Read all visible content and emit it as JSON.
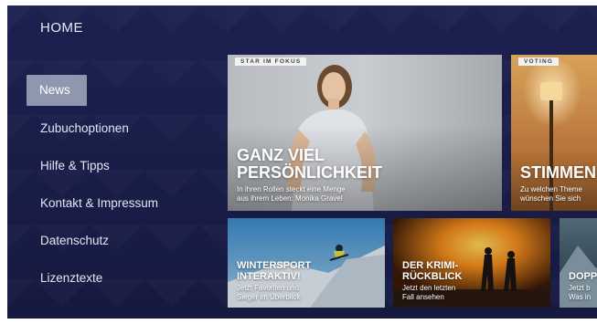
{
  "header": {
    "title": "HOME"
  },
  "menu": {
    "items": [
      {
        "label": "News"
      },
      {
        "label": "Zubuchoptionen"
      },
      {
        "label": "Hilfe & Tipps"
      },
      {
        "label": "Kontakt & Impressum"
      },
      {
        "label": "Datenschutz"
      },
      {
        "label": "Lizenztexte"
      }
    ]
  },
  "cards": {
    "featured": {
      "badge": "STAR IM FOKUS",
      "title_line1": "GANZ VIEL",
      "title_line2": "PERSÖNLICHKEIT",
      "sub_line1": "In ihren Rollen steckt eine Menge",
      "sub_line2": "aus ihrem Leben: Monika Gravel"
    },
    "voting": {
      "badge": "VOTING",
      "title": "STIMMEN",
      "sub_line1": "Zu welchen Theme",
      "sub_line2": "wünschen Sie sich"
    },
    "wintersport": {
      "title_line1": "WINTERSPORT",
      "title_line2": "INTERAKTIV!",
      "sub_line1": "Jetzt Favoriten und",
      "sub_line2": "Sieger im Überblick"
    },
    "krimi": {
      "title_line1": "DER KRIMI-",
      "title_line2": "RÜCKBLICK",
      "sub_line1": "Jetzt den letzten",
      "sub_line2": "Fall ansehen"
    },
    "partial": {
      "title": "DOPP",
      "sub_line1": "Jetzt b",
      "sub_line2": "Was in"
    }
  },
  "colors": {
    "background": "#1c2150",
    "menu_active": "#8f97af",
    "text": "#e3e6f2"
  }
}
